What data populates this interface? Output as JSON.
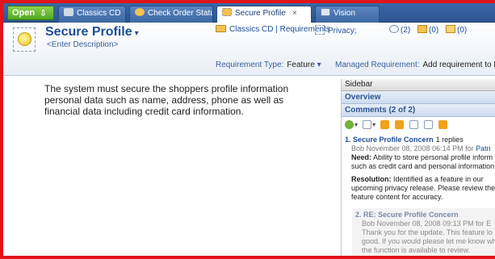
{
  "tabs": {
    "open_label": "Open",
    "items": [
      {
        "label": "Classics CD"
      },
      {
        "label": "Check Order Status"
      },
      {
        "label": "Secure Profile"
      },
      {
        "label": "Vision"
      }
    ],
    "close_glyph": "×"
  },
  "header": {
    "title": "Secure Profile",
    "description": "<Enter Description>",
    "breadcrumb": "Classics CD | Requirements",
    "privacy_label": "Privacy;",
    "comments_count": "(2)",
    "attachments_count": "(0)",
    "images_count": "(0)",
    "requirement_type_label": "Requirement Type:",
    "requirement_type_value": "Feature",
    "managed_label": "Managed Requirement:",
    "managed_value": "Add requirement to Requisi"
  },
  "content": {
    "text": "The system must secure the shoppers profile information personal data such as name, address, phone as well as financial data including credit card information."
  },
  "sidebar": {
    "title": "Sidebar",
    "overview_label": "Overview",
    "comments_label": "Comments (2 of 2)",
    "comment1": {
      "number": "1.",
      "title": "Secure Profile Concern",
      "replies": "1 replies",
      "meta": "Bob November 08, 2008 06:14 PM",
      "for_label": "for",
      "for_name": "Patri",
      "need_label": "Need:",
      "need_text": "Ability to store personal profile inform such as credit card and personal information.",
      "resolution_label": "Resolution:",
      "resolution_text": "Identified as a feature in our upcoming privacy release. Please review the feature content for accuracy."
    },
    "comment2": {
      "number": "2.",
      "title": "RE: Secure Profile Concern",
      "meta": "Bob November 08, 2008 09:13 PM",
      "for_label": "for",
      "for_name": "E",
      "text": "Thank you for the update. This feature lo good. If you would please let me know wh the function is available to review."
    }
  },
  "colors": {
    "border": "#e0141a",
    "tabbar": "#2d5590",
    "title": "#1f4e96",
    "open_button": "#4ea821"
  },
  "icons": [
    "bulb-icon",
    "folder-icon",
    "privacy-icon",
    "comment-icon",
    "attachment-icon",
    "image-icon",
    "close-icon"
  ]
}
